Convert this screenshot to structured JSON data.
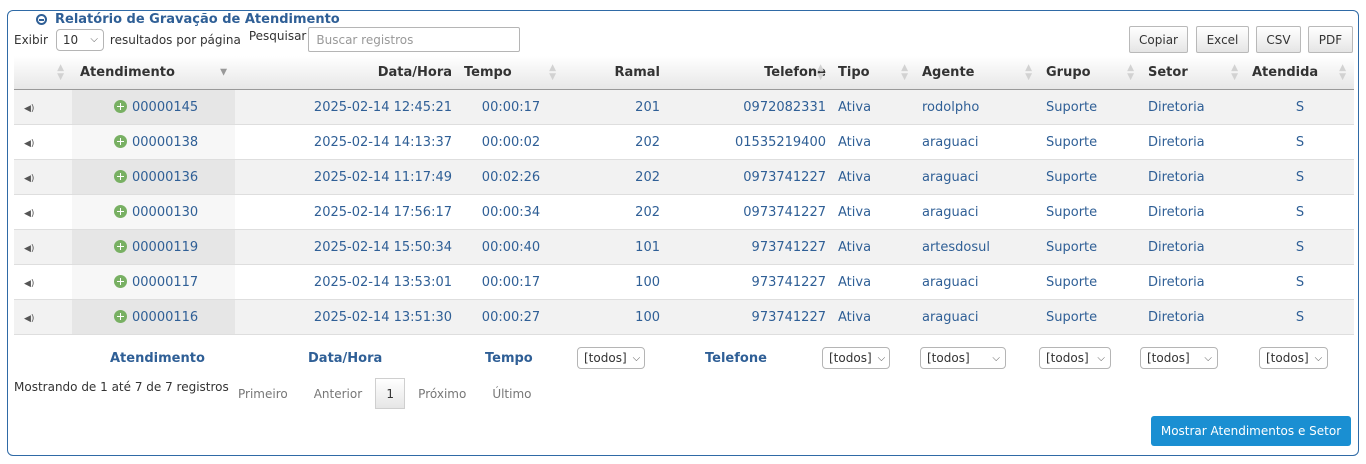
{
  "panel": {
    "title": "Relatório de Gravação de Atendimento"
  },
  "controls": {
    "show_label": "Exibir",
    "page_size": "10",
    "per_page_label": "resultados por página",
    "search_label": "Pesquisar",
    "search_placeholder": "Buscar registros"
  },
  "export_buttons": {
    "copy": "Copiar",
    "excel": "Excel",
    "csv": "CSV",
    "pdf": "PDF"
  },
  "table": {
    "headers": [
      "",
      "Atendimento",
      "Data/Hora",
      "Tempo",
      "Ramal",
      "Telefone",
      "Tipo",
      "Agente",
      "Grupo",
      "Setor",
      "Atendida"
    ],
    "rows": [
      {
        "atendimento": "00000145",
        "data_hora": "2025-02-14 12:45:21",
        "tempo": "00:00:17",
        "ramal": "201",
        "telefone": "0972082331",
        "tipo": "Ativa",
        "agente": "rodolpho",
        "grupo": "Suporte",
        "setor": "Diretoria",
        "atendida": "S"
      },
      {
        "atendimento": "00000138",
        "data_hora": "2025-02-14 14:13:37",
        "tempo": "00:00:02",
        "ramal": "202",
        "telefone": "01535219400",
        "tipo": "Ativa",
        "agente": "araguaci",
        "grupo": "Suporte",
        "setor": "Diretoria",
        "atendida": "S"
      },
      {
        "atendimento": "00000136",
        "data_hora": "2025-02-14 11:17:49",
        "tempo": "00:02:26",
        "ramal": "202",
        "telefone": "0973741227",
        "tipo": "Ativa",
        "agente": "araguaci",
        "grupo": "Suporte",
        "setor": "Diretoria",
        "atendida": "S"
      },
      {
        "atendimento": "00000130",
        "data_hora": "2025-02-14 17:56:17",
        "tempo": "00:00:34",
        "ramal": "202",
        "telefone": "0973741227",
        "tipo": "Ativa",
        "agente": "araguaci",
        "grupo": "Suporte",
        "setor": "Diretoria",
        "atendida": "S"
      },
      {
        "atendimento": "00000119",
        "data_hora": "2025-02-14 15:50:34",
        "tempo": "00:00:40",
        "ramal": "101",
        "telefone": "973741227",
        "tipo": "Ativa",
        "agente": "artesdosul",
        "grupo": "Suporte",
        "setor": "Diretoria",
        "atendida": "S"
      },
      {
        "atendimento": "00000117",
        "data_hora": "2025-02-14 13:53:01",
        "tempo": "00:00:17",
        "ramal": "100",
        "telefone": "973741227",
        "tipo": "Ativa",
        "agente": "araguaci",
        "grupo": "Suporte",
        "setor": "Diretoria",
        "atendida": "S"
      },
      {
        "atendimento": "00000116",
        "data_hora": "2025-02-14 13:51:30",
        "tempo": "00:00:27",
        "ramal": "100",
        "telefone": "973741227",
        "tipo": "Ativa",
        "agente": "araguaci",
        "grupo": "Suporte",
        "setor": "Diretoria",
        "atendida": "S"
      }
    ]
  },
  "footer": {
    "atendimento": "Atendimento",
    "data_hora": "Data/Hora",
    "tempo": "Tempo",
    "telefone": "Telefone",
    "filter_all": "[todos]"
  },
  "pagination": {
    "info": "Mostrando de 1 até 7 de 7 registros",
    "first": "Primeiro",
    "previous": "Anterior",
    "current": "1",
    "next": "Próximo",
    "last": "Último"
  },
  "primary_button": "Mostrar Atendimentos e Setor",
  "icons": {
    "row_audio": "speaker-icon",
    "row_expand": "plus-circle-icon",
    "panel_toggle": "minus-circle-icon"
  },
  "colors": {
    "link": "#2f5f96",
    "primary": "#1a8fd2",
    "expand_icon": "#78b063"
  }
}
